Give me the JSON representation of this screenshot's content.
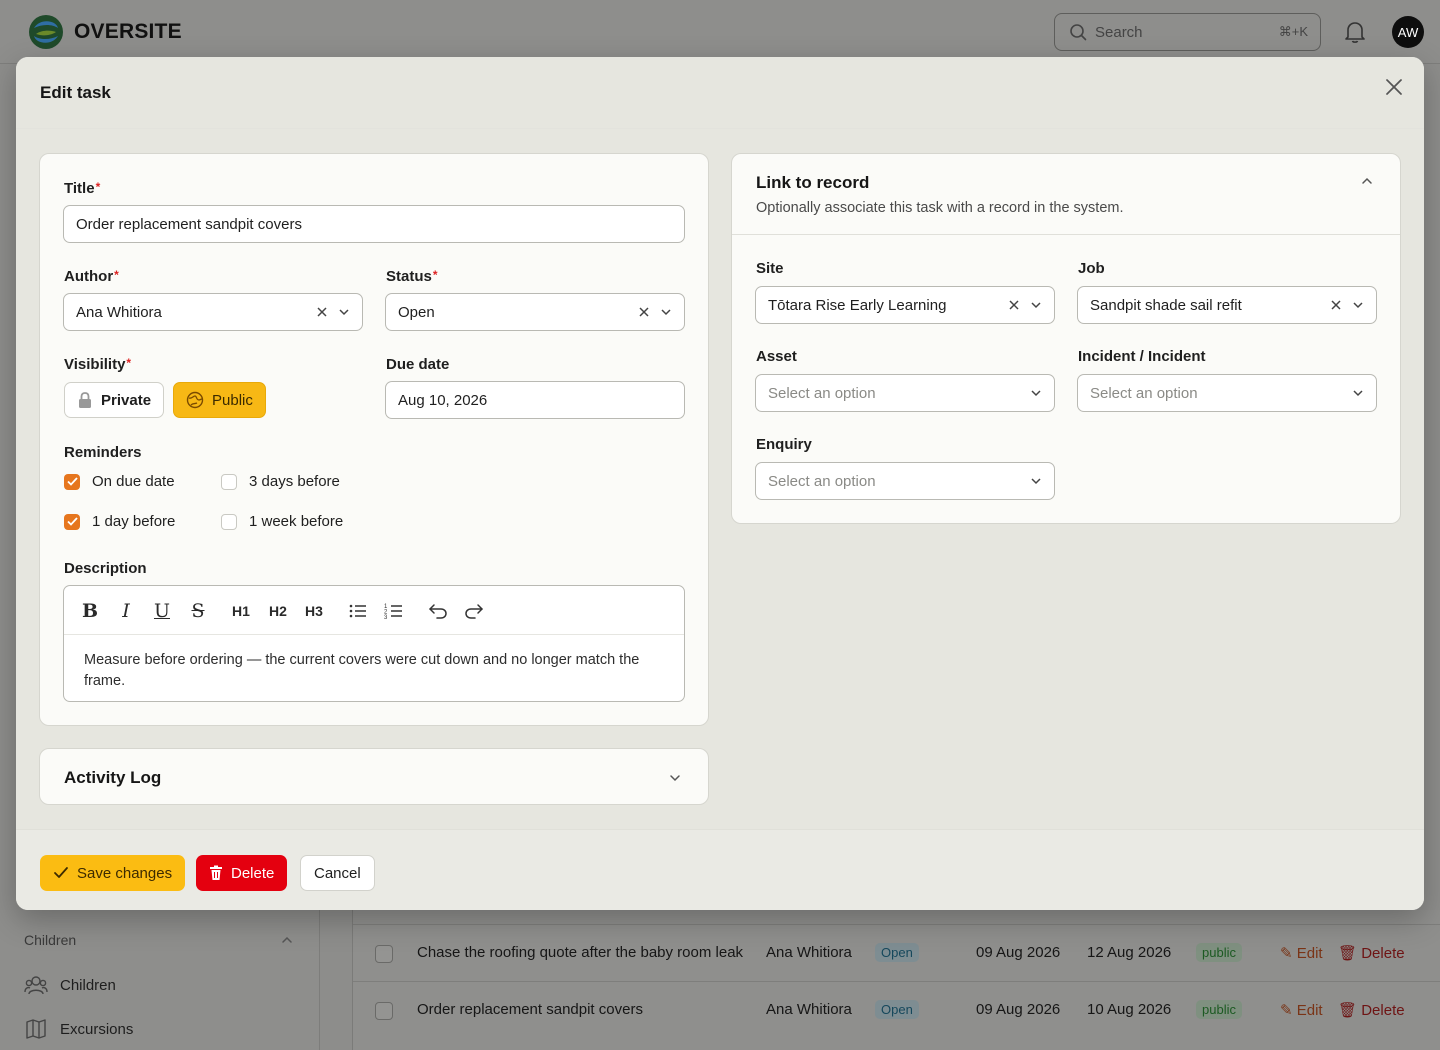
{
  "app": {
    "logo_text": "OVERSITE",
    "search_placeholder": "Search",
    "search_shortcut": "⌘+K",
    "avatar_initials": "AW"
  },
  "sidebar": {
    "group_label": "Children",
    "items": [
      {
        "label": "Children",
        "icon": "users-icon"
      },
      {
        "label": "Excursions",
        "icon": "map-icon"
      }
    ]
  },
  "table": {
    "rows": [
      {
        "title": "Chase the roofing quote after the baby room leak",
        "author": "Ana Whitiora",
        "status": "Open",
        "created": "09 Aug 2026",
        "due": "12 Aug 2026",
        "visibility": "public",
        "edit": "Edit",
        "delete": "Delete"
      },
      {
        "title": "Order replacement sandpit covers",
        "author": "Ana Whitiora",
        "status": "Open",
        "created": "09 Aug 2026",
        "due": "10 Aug 2026",
        "visibility": "public",
        "edit": "Edit",
        "delete": "Delete"
      }
    ]
  },
  "modal": {
    "title": "Edit task",
    "form": {
      "title_label": "Title",
      "title_value": "Order replacement sandpit covers",
      "author_label": "Author",
      "author_value": "Ana Whitiora",
      "status_label": "Status",
      "status_value": "Open",
      "visibility_label": "Visibility",
      "visibility_private": "Private",
      "visibility_public": "Public",
      "due_label": "Due date",
      "due_value": "Aug 10, 2026",
      "reminders_label": "Reminders",
      "reminders": [
        {
          "label": "On due date",
          "checked": true
        },
        {
          "label": "3 days before",
          "checked": false
        },
        {
          "label": "1 day before",
          "checked": true
        },
        {
          "label": "1 week before",
          "checked": false
        }
      ],
      "description_label": "Description",
      "description_text": "Measure before ordering — the current covers were cut down and no longer match the frame.",
      "toolbar": {
        "h1": "H1",
        "h2": "H2",
        "h3": "H3"
      }
    },
    "activity_log": {
      "title": "Activity Log"
    },
    "link": {
      "title": "Link to record",
      "subtitle": "Optionally associate this task with a record in the system.",
      "site_label": "Site",
      "site_value": "Tōtara Rise Early Learning",
      "job_label": "Job",
      "job_value": "Sandpit shade sail refit",
      "asset_label": "Asset",
      "asset_placeholder": "Select an option",
      "incident_label": "Incident / Incident",
      "incident_placeholder": "Select an option",
      "enquiry_label": "Enquiry",
      "enquiry_placeholder": "Select an option"
    },
    "footer": {
      "save": "Save changes",
      "delete": "Delete",
      "cancel": "Cancel"
    }
  },
  "colors": {
    "accent": "#fbbc12",
    "danger": "#e4000f",
    "checkbox": "#e6761e",
    "required": "#dd2222"
  }
}
